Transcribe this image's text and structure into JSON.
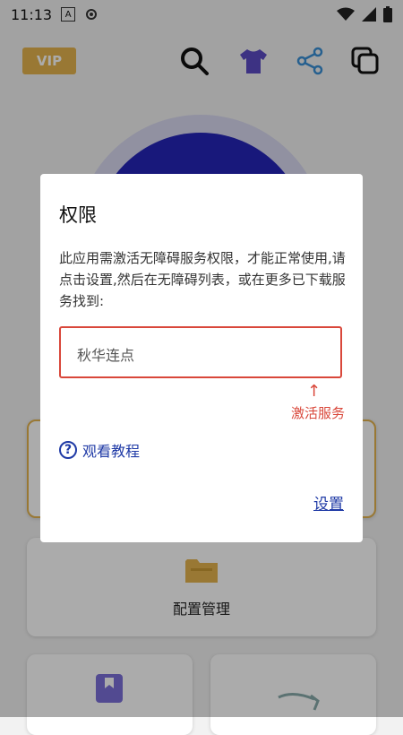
{
  "status_bar": {
    "time": "11:13",
    "a_icon_text": "A"
  },
  "toolbar": {
    "vip_label": "VIP"
  },
  "cards": {
    "config_label": "配置管理"
  },
  "dialog": {
    "title": "权限",
    "message": "此应用需激活无障碍服务权限，才能正常使用,请点击设置,然后在无障碍列表，或在更多已下载服务找到:",
    "service_name": "秋华连点",
    "arrow": "↑",
    "activate_label": "激活服务",
    "tutorial_label": "观看教程",
    "settings_label": "设置"
  },
  "colors": {
    "accent": "#1f3aa6",
    "warning": "#d9473a",
    "vip": "#e4b44e",
    "main_circle": "#2424b8"
  },
  "icons": [
    "search-icon",
    "shirt-icon",
    "share-icon",
    "copy-icon",
    "question-icon",
    "folder-icon"
  ]
}
